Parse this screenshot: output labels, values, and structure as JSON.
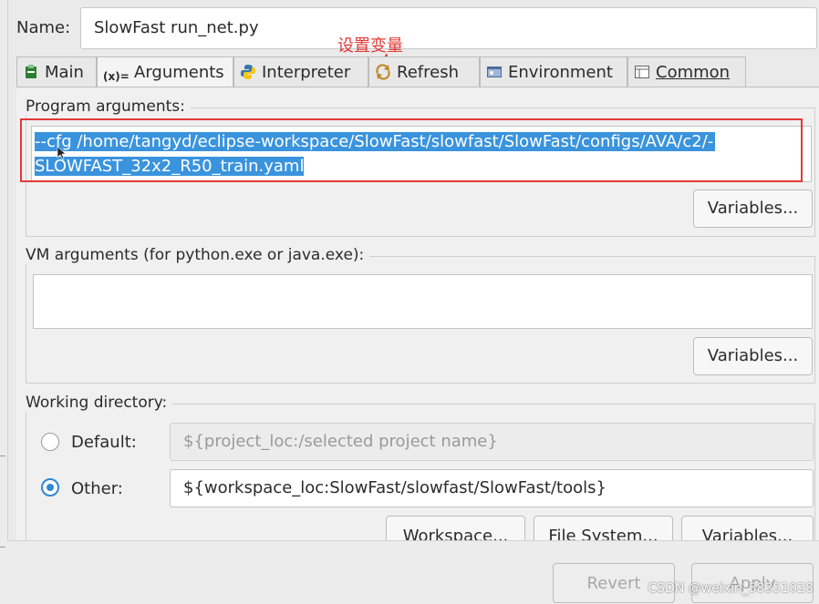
{
  "name_label": "Name:",
  "name_value": "SlowFast run_net.py",
  "annotation": "设置变量",
  "tabs": [
    {
      "label": "Main",
      "icon": "main-tab-icon"
    },
    {
      "label": "Arguments",
      "icon": "variables-icon"
    },
    {
      "label": "Interpreter",
      "icon": "python-icon"
    },
    {
      "label": "Refresh",
      "icon": "refresh-icon"
    },
    {
      "label": "Environment",
      "icon": "environment-icon"
    },
    {
      "label": "Common",
      "icon": "common-icon"
    }
  ],
  "active_tab": "Arguments",
  "program_args": {
    "label": "Program arguments:",
    "line1": "--cfg /home/tangyd/eclipse-workspace/SlowFast/slowfast/SlowFast/configs/AVA/c2/-",
    "line2": "SLOWFAST_32x2_R50_train.yaml",
    "variables_button": "Variables..."
  },
  "vm_args": {
    "label": "VM arguments (for python.exe or java.exe):",
    "value": "",
    "variables_button": "Variables..."
  },
  "working_dir": {
    "label": "Working directory:",
    "default_label": "Default:",
    "default_value": "${project_loc:/selected project name}",
    "other_label": "Other:",
    "other_value": "${workspace_loc:SlowFast/slowfast/SlowFast/tools}",
    "selected": "Other",
    "buttons": [
      "Workspace...",
      "File System...",
      "Variables..."
    ]
  },
  "footer": {
    "revert": "Revert",
    "apply": "Apply"
  },
  "watermark": "CSDN @weixin_58351028",
  "colors": {
    "selection": "#3a93dd",
    "annotation": "#e53935",
    "radio_selected": "#2f87d6"
  }
}
